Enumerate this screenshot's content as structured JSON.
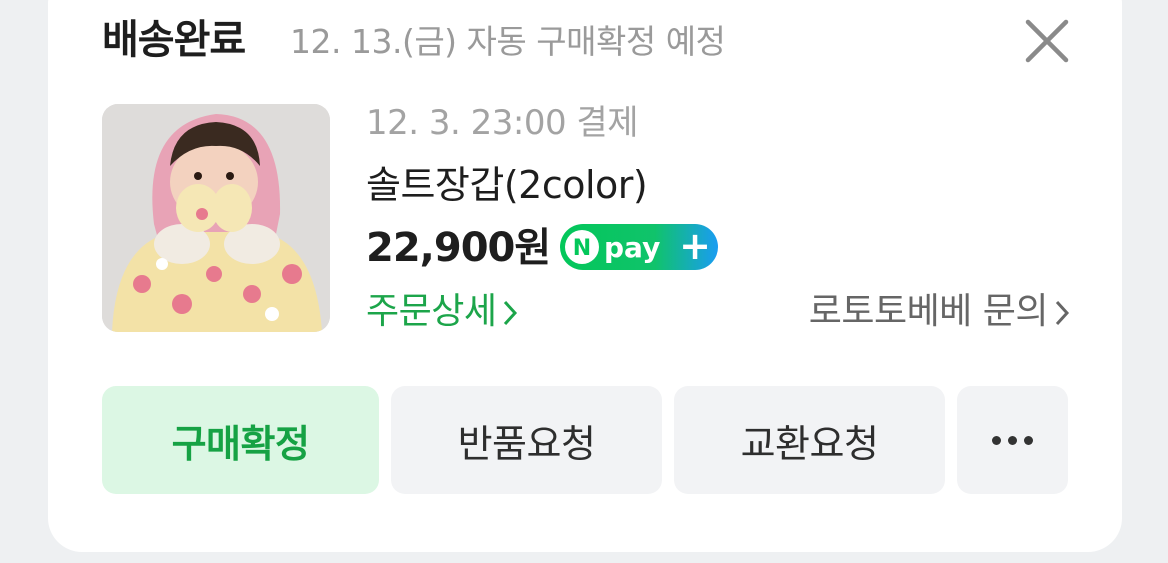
{
  "header": {
    "status": "배송완료",
    "auto_confirm": "12. 13.(금) 자동 구매확정 예정",
    "close_icon": "close-icon"
  },
  "order": {
    "paid_at": "12. 3. 23:00 결제",
    "product_name": "솔트장갑(2color)",
    "price": "22,900원",
    "npay_badge": {
      "n": "N",
      "text": "pay",
      "plus": "+",
      "icon": "npay-plus-badge"
    },
    "order_detail_link": "주문상세",
    "seller_inquiry_link": "로토토베베 문의"
  },
  "actions": {
    "confirm": "구매확정",
    "return": "반품요청",
    "exchange": "교환요청",
    "more_icon": "more-horizontal-icon"
  },
  "colors": {
    "accent_green": "#1ca54a",
    "confirm_bg": "#dcf7e4",
    "button_bg": "#f2f3f5",
    "muted_text": "#9a9a9a"
  }
}
